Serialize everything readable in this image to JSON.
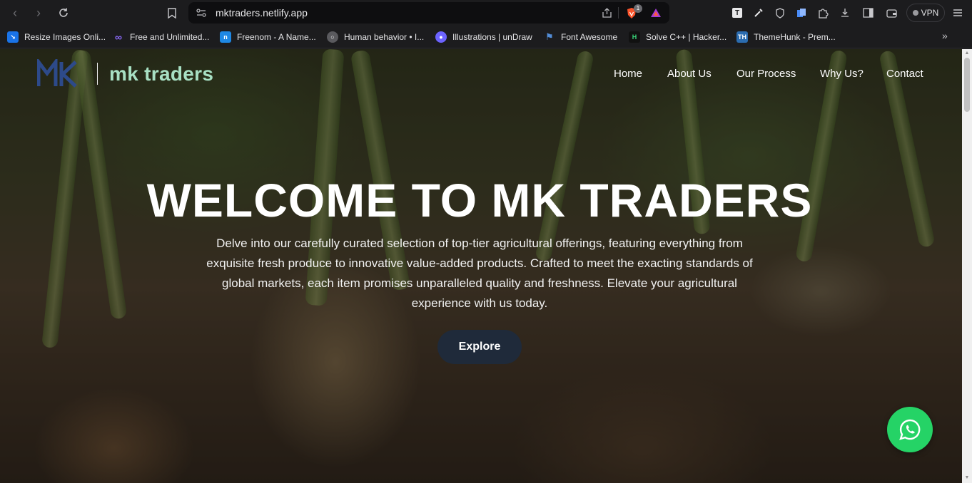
{
  "browser": {
    "url": "mktraders.netlify.app",
    "vpn_label": "VPN",
    "brave_badge": "1",
    "bookmarks": [
      {
        "label": "Resize Images Onli...",
        "icon": "resize-images-icon",
        "color": "#1a73e8"
      },
      {
        "label": "Free and Unlimited...",
        "icon": "infinity-icon",
        "color": "#7b5cff"
      },
      {
        "label": "Freenom - A Name...",
        "icon": "freenom-icon",
        "color": "#1e88e5"
      },
      {
        "label": "Human behavior • I...",
        "icon": "globe-icon",
        "color": "#8a8a8e"
      },
      {
        "label": "Illustrations | unDraw",
        "icon": "undraw-icon",
        "color": "#6c63ff"
      },
      {
        "label": "Font Awesome",
        "icon": "font-awesome-flag-icon",
        "color": "#538dd7"
      },
      {
        "label": "Solve C++ | Hacker...",
        "icon": "hackerrank-icon",
        "color": "#111111"
      },
      {
        "label": "ThemeHunk - Prem...",
        "icon": "themehunk-icon",
        "color": "#2b6cb0"
      }
    ]
  },
  "site": {
    "brand": "mk traders",
    "logo_letters": "MK",
    "nav": [
      "Home",
      "About Us",
      "Our Process",
      "Why Us?",
      "Contact"
    ],
    "hero": {
      "title": "WELCOME TO MK TRADERS",
      "text": "Delve into our carefully curated selection of top-tier agricultural offerings, featuring everything from exquisite fresh produce to innovative value-added products. Crafted to meet the exacting standards of global markets, each item promises unparalleled quality and freshness. Elevate your agricultural experience with us today.",
      "button": "Explore"
    },
    "colors": {
      "brand_text": "#a8e0c4",
      "button_bg": "#1f2a3a",
      "whatsapp": "#25d366"
    }
  }
}
